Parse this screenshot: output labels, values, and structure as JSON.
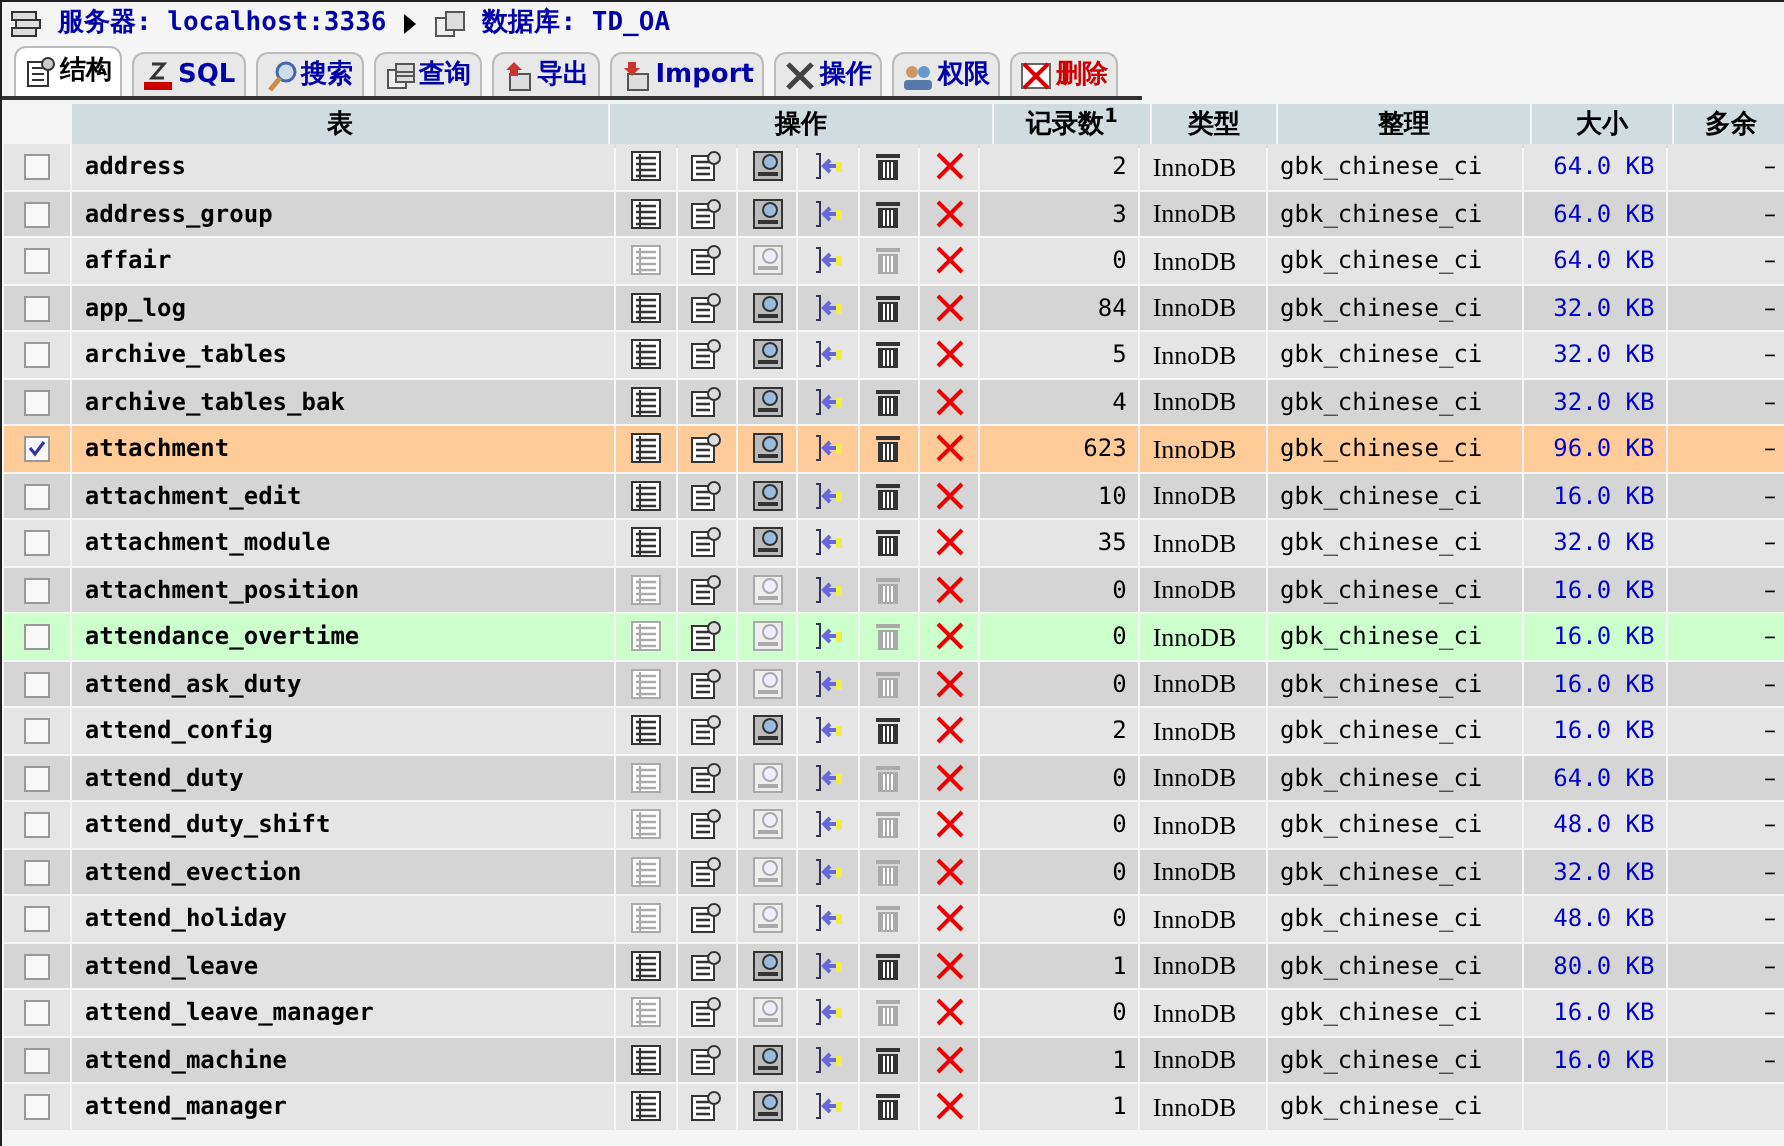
{
  "breadcrumb": {
    "server": "服务器: localhost:3336",
    "database": "数据库: TD_OA"
  },
  "tabs": [
    {
      "label": "结构",
      "kind": "structure",
      "selected": true
    },
    {
      "label": "SQL",
      "kind": "sql",
      "selected": false
    },
    {
      "label": "搜索",
      "kind": "search",
      "selected": false
    },
    {
      "label": "查询",
      "kind": "query",
      "selected": false
    },
    {
      "label": "导出",
      "kind": "export",
      "selected": false
    },
    {
      "label": "Import",
      "kind": "import",
      "selected": false
    },
    {
      "label": "操作",
      "kind": "tools",
      "selected": false
    },
    {
      "label": "权限",
      "kind": "users",
      "selected": false
    },
    {
      "label": "删除",
      "kind": "drop",
      "selected": false
    }
  ],
  "table": {
    "columns": [
      "表",
      "操作",
      "记录数$^{1}$",
      "类型",
      "整理",
      "大小",
      "多余"
    ],
    "rows": [
      {
        "name": "address",
        "records": "2",
        "type": "InnoDB",
        "collation": "gbk_chinese_ci",
        "size": "64.0 KB",
        "overhead": "–",
        "checked": false,
        "hovered": false,
        "has_data": true
      },
      {
        "name": "address_group",
        "records": "3",
        "type": "InnoDB",
        "collation": "gbk_chinese_ci",
        "size": "64.0 KB",
        "overhead": "–",
        "checked": false,
        "hovered": false,
        "has_data": true
      },
      {
        "name": "affair",
        "records": "0",
        "type": "InnoDB",
        "collation": "gbk_chinese_ci",
        "size": "64.0 KB",
        "overhead": "–",
        "checked": false,
        "hovered": false,
        "has_data": false
      },
      {
        "name": "app_log",
        "records": "84",
        "type": "InnoDB",
        "collation": "gbk_chinese_ci",
        "size": "32.0 KB",
        "overhead": "–",
        "checked": false,
        "hovered": false,
        "has_data": true
      },
      {
        "name": "archive_tables",
        "records": "5",
        "type": "InnoDB",
        "collation": "gbk_chinese_ci",
        "size": "32.0 KB",
        "overhead": "–",
        "checked": false,
        "hovered": false,
        "has_data": true
      },
      {
        "name": "archive_tables_bak",
        "records": "4",
        "type": "InnoDB",
        "collation": "gbk_chinese_ci",
        "size": "32.0 KB",
        "overhead": "–",
        "checked": false,
        "hovered": false,
        "has_data": true
      },
      {
        "name": "attachment",
        "records": "623",
        "type": "InnoDB",
        "collation": "gbk_chinese_ci",
        "size": "96.0 KB",
        "overhead": "–",
        "checked": true,
        "hovered": false,
        "has_data": true
      },
      {
        "name": "attachment_edit",
        "records": "10",
        "type": "InnoDB",
        "collation": "gbk_chinese_ci",
        "size": "16.0 KB",
        "overhead": "–",
        "checked": false,
        "hovered": false,
        "has_data": true
      },
      {
        "name": "attachment_module",
        "records": "35",
        "type": "InnoDB",
        "collation": "gbk_chinese_ci",
        "size": "32.0 KB",
        "overhead": "–",
        "checked": false,
        "hovered": false,
        "has_data": true
      },
      {
        "name": "attachment_position",
        "records": "0",
        "type": "InnoDB",
        "collation": "gbk_chinese_ci",
        "size": "16.0 KB",
        "overhead": "–",
        "checked": false,
        "hovered": false,
        "has_data": false
      },
      {
        "name": "attendance_overtime",
        "records": "0",
        "type": "InnoDB",
        "collation": "gbk_chinese_ci",
        "size": "16.0 KB",
        "overhead": "–",
        "checked": false,
        "hovered": true,
        "has_data": false
      },
      {
        "name": "attend_ask_duty",
        "records": "0",
        "type": "InnoDB",
        "collation": "gbk_chinese_ci",
        "size": "16.0 KB",
        "overhead": "–",
        "checked": false,
        "hovered": false,
        "has_data": false
      },
      {
        "name": "attend_config",
        "records": "2",
        "type": "InnoDB",
        "collation": "gbk_chinese_ci",
        "size": "16.0 KB",
        "overhead": "–",
        "checked": false,
        "hovered": false,
        "has_data": true
      },
      {
        "name": "attend_duty",
        "records": "0",
        "type": "InnoDB",
        "collation": "gbk_chinese_ci",
        "size": "64.0 KB",
        "overhead": "–",
        "checked": false,
        "hovered": false,
        "has_data": false
      },
      {
        "name": "attend_duty_shift",
        "records": "0",
        "type": "InnoDB",
        "collation": "gbk_chinese_ci",
        "size": "48.0 KB",
        "overhead": "–",
        "checked": false,
        "hovered": false,
        "has_data": false
      },
      {
        "name": "attend_evection",
        "records": "0",
        "type": "InnoDB",
        "collation": "gbk_chinese_ci",
        "size": "32.0 KB",
        "overhead": "–",
        "checked": false,
        "hovered": false,
        "has_data": false
      },
      {
        "name": "attend_holiday",
        "records": "0",
        "type": "InnoDB",
        "collation": "gbk_chinese_ci",
        "size": "48.0 KB",
        "overhead": "–",
        "checked": false,
        "hovered": false,
        "has_data": false
      },
      {
        "name": "attend_leave",
        "records": "1",
        "type": "InnoDB",
        "collation": "gbk_chinese_ci",
        "size": "80.0 KB",
        "overhead": "–",
        "checked": false,
        "hovered": false,
        "has_data": true
      },
      {
        "name": "attend_leave_manager",
        "records": "0",
        "type": "InnoDB",
        "collation": "gbk_chinese_ci",
        "size": "16.0 KB",
        "overhead": "–",
        "checked": false,
        "hovered": false,
        "has_data": false
      },
      {
        "name": "attend_machine",
        "records": "1",
        "type": "InnoDB",
        "collation": "gbk_chinese_ci",
        "size": "16.0 KB",
        "overhead": "–",
        "checked": false,
        "hovered": false,
        "has_data": true
      },
      {
        "name": "attend_manager",
        "records": "1",
        "type": "InnoDB",
        "collation": "gbk_chinese_ci",
        "checked": false,
        "hovered": false,
        "has_data": true
      }
    ]
  }
}
